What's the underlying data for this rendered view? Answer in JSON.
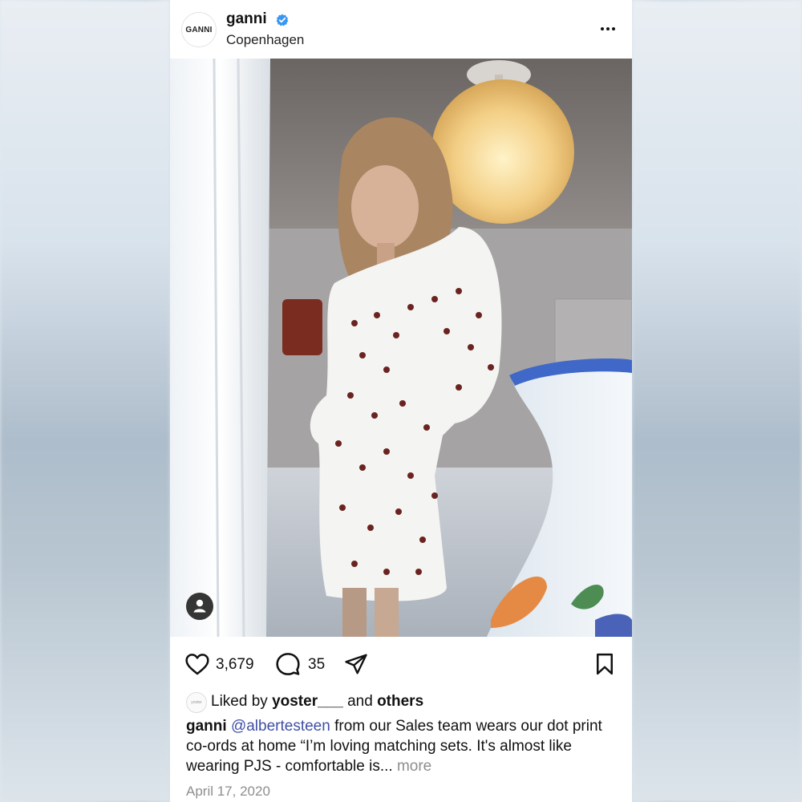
{
  "header": {
    "avatar_text": "GANNI",
    "username": "ganni",
    "location": "Copenhagen"
  },
  "actions": {
    "likes": "3,679",
    "comments": "35"
  },
  "liked_by": {
    "prefix": "Liked by",
    "user": "yoster___",
    "middle": "and",
    "others": "others"
  },
  "caption": {
    "username": "ganni",
    "mention": "@albertesteen",
    "text": "from our Sales team wears our dot print co-ords at home “I’m loving matching sets. It's almost like wearing PJS - comfortable is...",
    "more": "more"
  },
  "date": "April 17, 2020",
  "colors": {
    "verified": "#3897f0",
    "mention": "#3f4fa6"
  }
}
